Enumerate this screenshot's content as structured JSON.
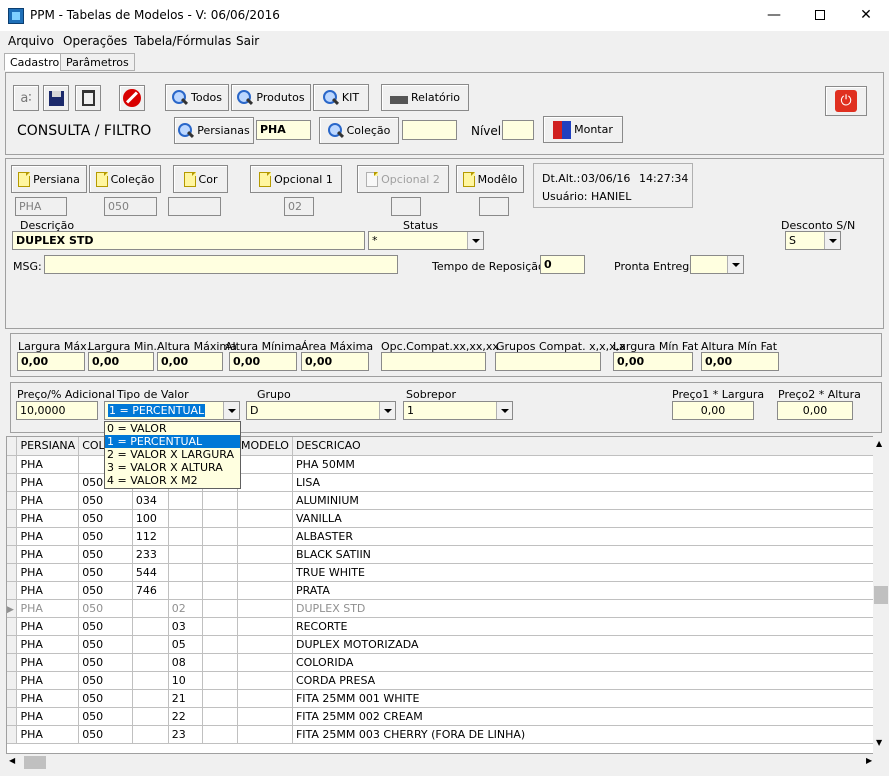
{
  "window": {
    "title": "PPM - Tabelas de Modelos - V: 06/06/2016"
  },
  "menu": [
    "Arquivo",
    "Operações",
    "Tabela/Fórmulas",
    "Sair"
  ],
  "tabs": [
    "Cadastro",
    "Parâmetros"
  ],
  "toolbar": {
    "todos": "Todos",
    "produtos": "Produtos",
    "kit": "KIT",
    "relatorio": "Relatório",
    "consulta_label": "CONSULTA / FILTRO",
    "persianas": "Persianas",
    "persianas_value": "PHA",
    "colecao": "Coleção",
    "colecao_value": "",
    "nivel_label": "Nível",
    "nivel_value": "",
    "montar": "Montar"
  },
  "form": {
    "persiana": "Persiana",
    "colecao": "Coleção",
    "cor": "Cor",
    "opcional1": "Opcional 1",
    "opcional2": "Opcional 2",
    "modelo": "Modêlo",
    "persiana_val": "PHA",
    "colecao_val": "050",
    "cor_val": "",
    "opc1_val": "02",
    "opc2_val": "",
    "modelo_val": "",
    "dtalt_label": "Dt.Alt.:",
    "dtalt_date": "03/06/16",
    "dtalt_time": "14:27:34",
    "usuario_label": "Usuário:",
    "usuario": "HANIEL",
    "descricao_label": "Descrição",
    "descricao": "DUPLEX STD",
    "status_label": "Status",
    "status": "*",
    "desconto_label": "Desconto S/N",
    "desconto": "S",
    "msg_label": "MSG:",
    "msg": "",
    "tempo_label": "Tempo de Reposição",
    "tempo": "0",
    "pronta_label": "Pronta Entrega",
    "pronta": ""
  },
  "dims": {
    "largmax_label": "Largura Máx.",
    "largmax": "0,00",
    "largmin_label": "Largura Min.",
    "largmin": "0,00",
    "altmax_label": "Altura Máxima",
    "altmax": "0,00",
    "altmin_label": "Altura Mínima",
    "altmin": "0,00",
    "area_label": "Área Máxima",
    "area": "0,00",
    "opc_label": "Opc.Compat.xx,xx,xx",
    "opc": "",
    "grupos_label": "Grupos Compat. x,x,x,x",
    "grupos": "",
    "largfat_label": "Largura Mín Fat",
    "largfat": "0,00",
    "altfat_label": "Altura Mín Fat",
    "altfat": "0,00"
  },
  "preco": {
    "preco_label": "Preço/% Adicional",
    "preco": "10,0000",
    "tipo_label": "Tipo de Valor",
    "tipo": "1 = PERCENTUAL",
    "grupo_label": "Grupo",
    "grupo": "D",
    "sobrepor_label": "Sobrepor",
    "sobrepor": "1",
    "p1_label": "Preço1 * Largura",
    "p1": "0,00",
    "p2_label": "Preço2 * Altura",
    "p2": "0,00"
  },
  "tipo_options": [
    "0 = VALOR",
    "1 = PERCENTUAL",
    "2 = VALOR X LARGURA",
    "3 = VALOR X ALTURA",
    "4 = VALOR X M2"
  ],
  "grid": {
    "columns": [
      "PERSIANA",
      "COLE",
      "",
      "",
      "",
      "MODELO",
      "DESCRICAO"
    ],
    "rows": [
      [
        "PHA",
        "",
        "",
        "",
        "",
        "",
        "PHA 50MM"
      ],
      [
        "PHA",
        "050",
        "",
        "",
        "",
        "",
        "LISA"
      ],
      [
        "PHA",
        "050",
        "034",
        "",
        "",
        "",
        "ALUMINIUM"
      ],
      [
        "PHA",
        "050",
        "100",
        "",
        "",
        "",
        "VANILLA"
      ],
      [
        "PHA",
        "050",
        "112",
        "",
        "",
        "",
        "ALBASTER"
      ],
      [
        "PHA",
        "050",
        "233",
        "",
        "",
        "",
        "BLACK SATIIN"
      ],
      [
        "PHA",
        "050",
        "544",
        "",
        "",
        "",
        "TRUE WHITE"
      ],
      [
        "PHA",
        "050",
        "746",
        "",
        "",
        "",
        "PRATA"
      ],
      [
        "PHA",
        "050",
        "",
        "02",
        "",
        "",
        "DUPLEX STD"
      ],
      [
        "PHA",
        "050",
        "",
        "03",
        "",
        "",
        "RECORTE"
      ],
      [
        "PHA",
        "050",
        "",
        "05",
        "",
        "",
        "DUPLEX MOTORIZADA"
      ],
      [
        "PHA",
        "050",
        "",
        "08",
        "",
        "",
        "COLORIDA"
      ],
      [
        "PHA",
        "050",
        "",
        "10",
        "",
        "",
        "CORDA PRESA"
      ],
      [
        "PHA",
        "050",
        "",
        "21",
        "",
        "",
        "FITA 25MM 001 WHITE"
      ],
      [
        "PHA",
        "050",
        "",
        "22",
        "",
        "",
        "FITA 25MM 002 CREAM"
      ],
      [
        "PHA",
        "050",
        "",
        "23",
        "",
        "",
        "FITA 25MM 003 CHERRY (FORA DE LINHA)"
      ]
    ]
  }
}
